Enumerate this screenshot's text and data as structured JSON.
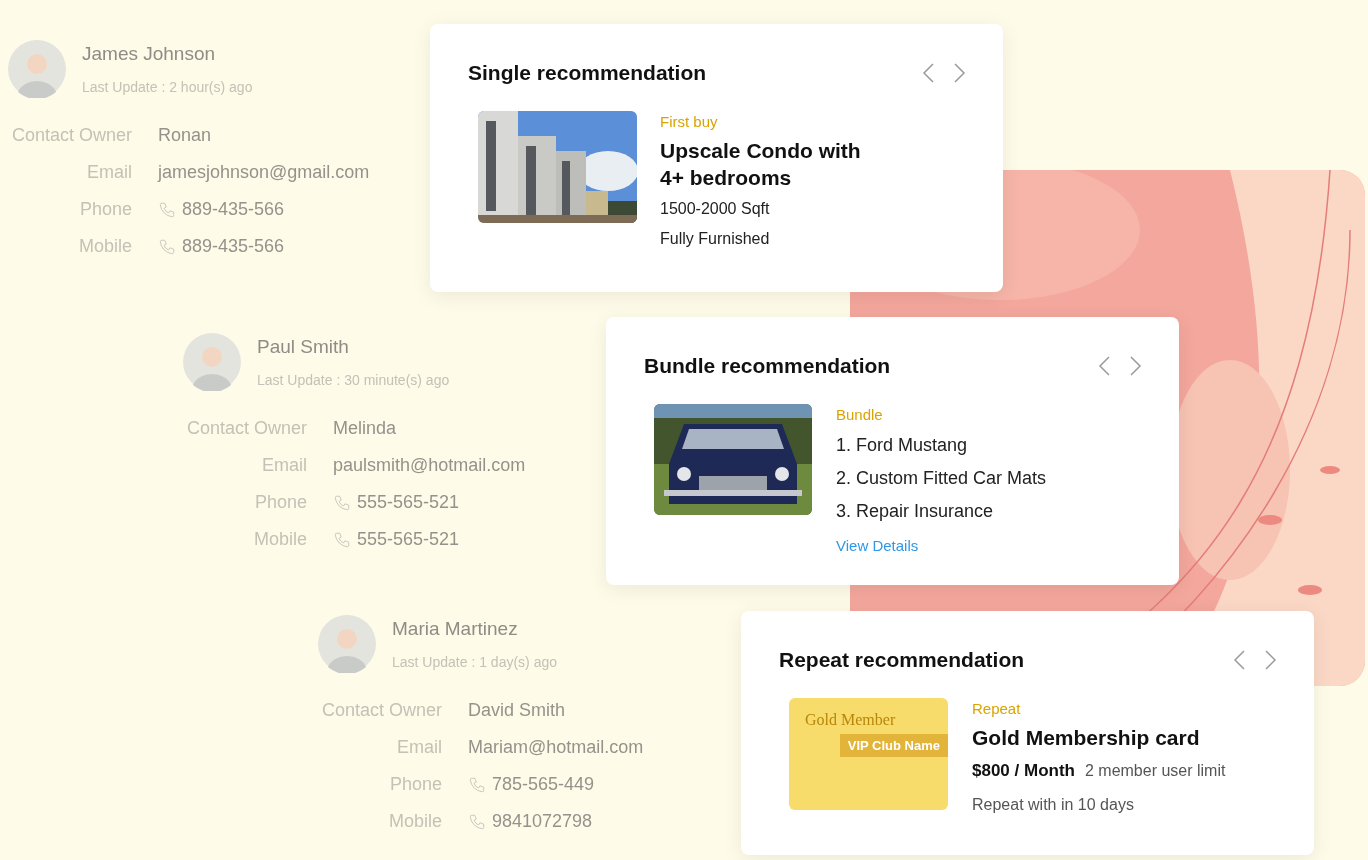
{
  "contacts": [
    {
      "name": "James Johnson",
      "last_update": "Last Update : 2 hour(s) ago",
      "fields": [
        {
          "label": "Contact Owner",
          "value": "Ronan",
          "kind": "text"
        },
        {
          "label": "Email",
          "value": "jamesjohnson@gmail.com",
          "kind": "text"
        },
        {
          "label": "Phone",
          "value": "889-435-566",
          "kind": "phone"
        },
        {
          "label": "Mobile",
          "value": "889-435-566",
          "kind": "phone"
        }
      ]
    },
    {
      "name": "Paul Smith",
      "last_update": "Last Update : 30 minute(s) ago",
      "fields": [
        {
          "label": "Contact Owner",
          "value": "Melinda",
          "kind": "text"
        },
        {
          "label": "Email",
          "value": "paulsmith@hotmail.com",
          "kind": "text"
        },
        {
          "label": "Phone",
          "value": "555-565-521",
          "kind": "phone"
        },
        {
          "label": "Mobile",
          "value": "555-565-521",
          "kind": "phone"
        }
      ]
    },
    {
      "name": "Maria Martinez",
      "last_update": "Last Update : 1 day(s) ago",
      "fields": [
        {
          "label": "Contact Owner",
          "value": "David Smith",
          "kind": "text"
        },
        {
          "label": "Email",
          "value": "Mariam@hotmail.com",
          "kind": "text"
        },
        {
          "label": "Phone",
          "value": "785-565-449",
          "kind": "phone"
        },
        {
          "label": "Mobile",
          "value": "9841072798",
          "kind": "phone"
        }
      ]
    }
  ],
  "recommendations": [
    {
      "kind": "single",
      "title": "Single recommendation",
      "tag": "First buy",
      "heading": "Upscale Condo with 4+ bedrooms",
      "lines": [
        "1500-2000 Sqft",
        "Fully Furnished"
      ]
    },
    {
      "kind": "bundle",
      "title": "Bundle recommendation",
      "tag": "Bundle",
      "items": [
        "1. Ford Mustang",
        "2. Custom Fitted Car Mats",
        "3. Repair Insurance"
      ],
      "link": "View Details"
    },
    {
      "kind": "repeat",
      "title": "Repeat recommendation",
      "tag": "Repeat",
      "heading": "Gold Membership card",
      "price": "$800 / Month",
      "detail": "2 member user limit",
      "note": "Repeat with in 10 days",
      "card": {
        "title": "Gold Member",
        "subtitle": "VIP Club Name"
      }
    }
  ]
}
